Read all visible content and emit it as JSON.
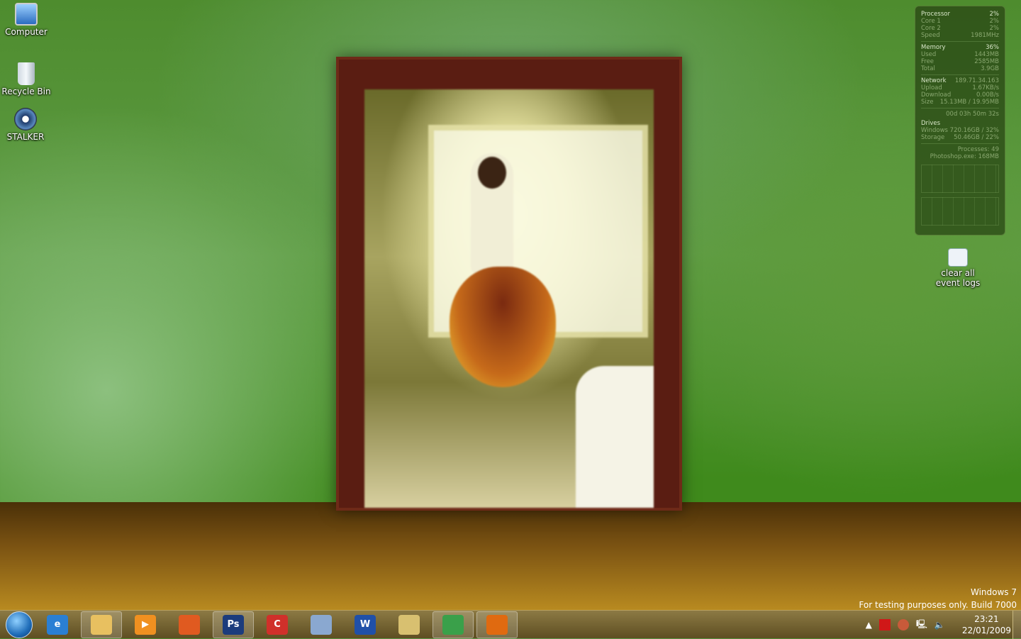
{
  "desktop_icons": [
    {
      "label": "Computer",
      "icon": "computer-icon"
    },
    {
      "label": "Recycle Bin",
      "icon": "recycle-bin-icon"
    },
    {
      "label": "STALKER",
      "icon": "stalker-icon"
    },
    {
      "label": "clear all event logs",
      "icon": "event-log-icon"
    }
  ],
  "gadget": {
    "processor": {
      "label": "Processor",
      "value": "2%",
      "core1_label": "Core 1",
      "core1": "2%",
      "core2_label": "Core 2",
      "core2": "2%",
      "speed_label": "Speed",
      "speed": "1981MHz"
    },
    "memory": {
      "label": "Memory",
      "value": "36%",
      "used_label": "Used",
      "used": "1443MB",
      "free_label": "Free",
      "free": "2585MB",
      "total_label": "Total",
      "total": "3.9GB"
    },
    "network": {
      "label": "Network",
      "ip": "189.71.34.163",
      "upload_label": "Upload",
      "upload": "1.67KB/s",
      "download_label": "Download",
      "download": "0.00B/s",
      "size_label": "Size",
      "size": "15.13MB / 19.95MB"
    },
    "uptime": "00d 03h 50m 32s",
    "drives": {
      "label": "Drives",
      "items": [
        {
          "name": "Windows 7",
          "value": "20.16GB / 32%"
        },
        {
          "name": "Storage",
          "value": "50.46GB / 22%"
        }
      ]
    },
    "processes": "Processes: 49",
    "top_process": "Photoshop.exe: 168MB"
  },
  "watermark": {
    "line1": "Windows  7",
    "line2": "For testing purposes only. Build 7000"
  },
  "taskbar": {
    "items": [
      {
        "name": "internet-explorer",
        "glyph": "e",
        "color": "#2a7fd4",
        "active": false
      },
      {
        "name": "windows-explorer",
        "glyph": "",
        "color": "#e8c060",
        "active": true
      },
      {
        "name": "media-player",
        "glyph": "▶",
        "color": "#f09020",
        "active": false
      },
      {
        "name": "paint",
        "glyph": "",
        "color": "#e05a20",
        "active": false
      },
      {
        "name": "photoshop",
        "glyph": "Ps",
        "color": "#1c3c7c",
        "active": true
      },
      {
        "name": "red-app",
        "glyph": "C",
        "color": "#d0302a",
        "active": false
      },
      {
        "name": "disc-app",
        "glyph": "",
        "color": "#8aa8d0",
        "active": false
      },
      {
        "name": "word",
        "glyph": "W",
        "color": "#2050a8",
        "active": false
      },
      {
        "name": "outlook",
        "glyph": "",
        "color": "#d8c070",
        "active": false
      },
      {
        "name": "messenger",
        "glyph": "",
        "color": "#3aa04a",
        "active": true
      },
      {
        "name": "firefox",
        "glyph": "",
        "color": "#e06a10",
        "active": true
      }
    ],
    "time": "23:21",
    "date": "22/01/2009"
  }
}
